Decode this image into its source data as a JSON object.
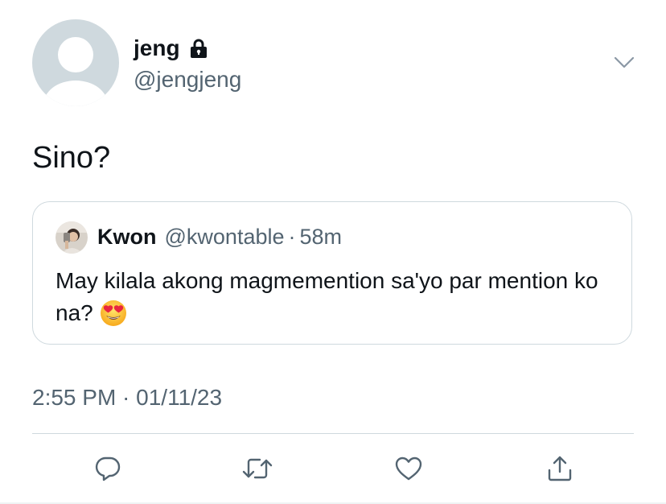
{
  "author": {
    "display_name": "jeng",
    "handle": "@jengjeng",
    "avatar_icon": "default-avatar-icon",
    "protected_icon": "lock-icon"
  },
  "tweet": {
    "text": "Sino?",
    "timestamp": "2:55 PM · 01/11/23"
  },
  "quoted_tweet": {
    "name": "Kwon",
    "handle": "@kwontable",
    "separator": "·",
    "time": "58m",
    "text": "May kilala akong magmemention sa'yo par mention ko na?",
    "emoji": "heart-eyes-emoji"
  },
  "actions": [
    {
      "name": "reply",
      "icon": "reply-icon"
    },
    {
      "name": "retweet",
      "icon": "retweet-icon"
    },
    {
      "name": "like",
      "icon": "heart-icon"
    },
    {
      "name": "share",
      "icon": "share-icon"
    }
  ],
  "colors": {
    "text": "#0f1419",
    "secondary": "#536471",
    "border": "#cfd9de",
    "avatar_bg": "#cfd9de"
  }
}
